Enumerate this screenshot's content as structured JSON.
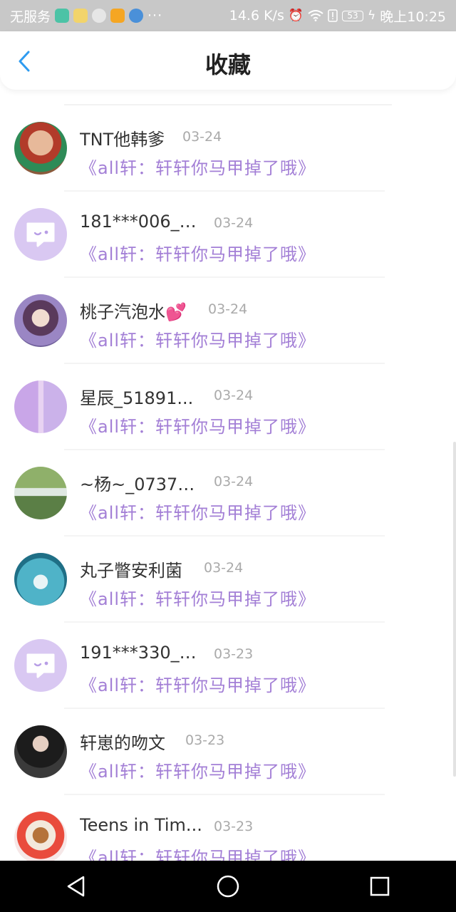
{
  "status_bar": {
    "carrier": "无服务",
    "more": "···",
    "speed": "14.6 K/s",
    "battery": "53",
    "time": "晚上10:25",
    "app_icons": [
      "clock-app-icon",
      "face-app-icon",
      "wechat-icon",
      "video-app-icon",
      "browser-app-icon"
    ]
  },
  "header": {
    "title": "收藏",
    "back_icon": "chevron-left-icon"
  },
  "favorites": [
    {
      "name": "TNT他韩爹",
      "date": "03-24",
      "title": "《all轩：轩轩你马甲掉了哦》",
      "avatar": "photo"
    },
    {
      "name": "181***006_8...",
      "date": "03-24",
      "title": "《all轩：轩轩你马甲掉了哦》",
      "avatar": "default"
    },
    {
      "name": "桃子汽泡水",
      "date": "03-24",
      "title": "《all轩：轩轩你马甲掉了哦》",
      "avatar": "photo",
      "emoji": "💕"
    },
    {
      "name": "星辰_51891...",
      "date": "03-24",
      "title": "《all轩：轩轩你马甲掉了哦》",
      "avatar": "photo"
    },
    {
      "name": "~杨~_07374...",
      "date": "03-24",
      "title": "《all轩：轩轩你马甲掉了哦》",
      "avatar": "photo"
    },
    {
      "name": "丸子瞥安利菌",
      "date": "03-24",
      "title": "《all轩：轩轩你马甲掉了哦》",
      "avatar": "photo"
    },
    {
      "name": "191***330_7...",
      "date": "03-23",
      "title": "《all轩：轩轩你马甲掉了哦》",
      "avatar": "default"
    },
    {
      "name": "轩崽的吻文",
      "date": "03-23",
      "title": "《all轩：轩轩你马甲掉了哦》",
      "avatar": "photo"
    },
    {
      "name": "Teens in Tim...",
      "date": "03-23",
      "title": "《all轩：轩轩你马甲掉了哦》",
      "avatar": "photo"
    }
  ],
  "nav_bar": {
    "back": "triangle-back-icon",
    "home": "circle-home-icon",
    "recents": "square-recents-icon"
  }
}
